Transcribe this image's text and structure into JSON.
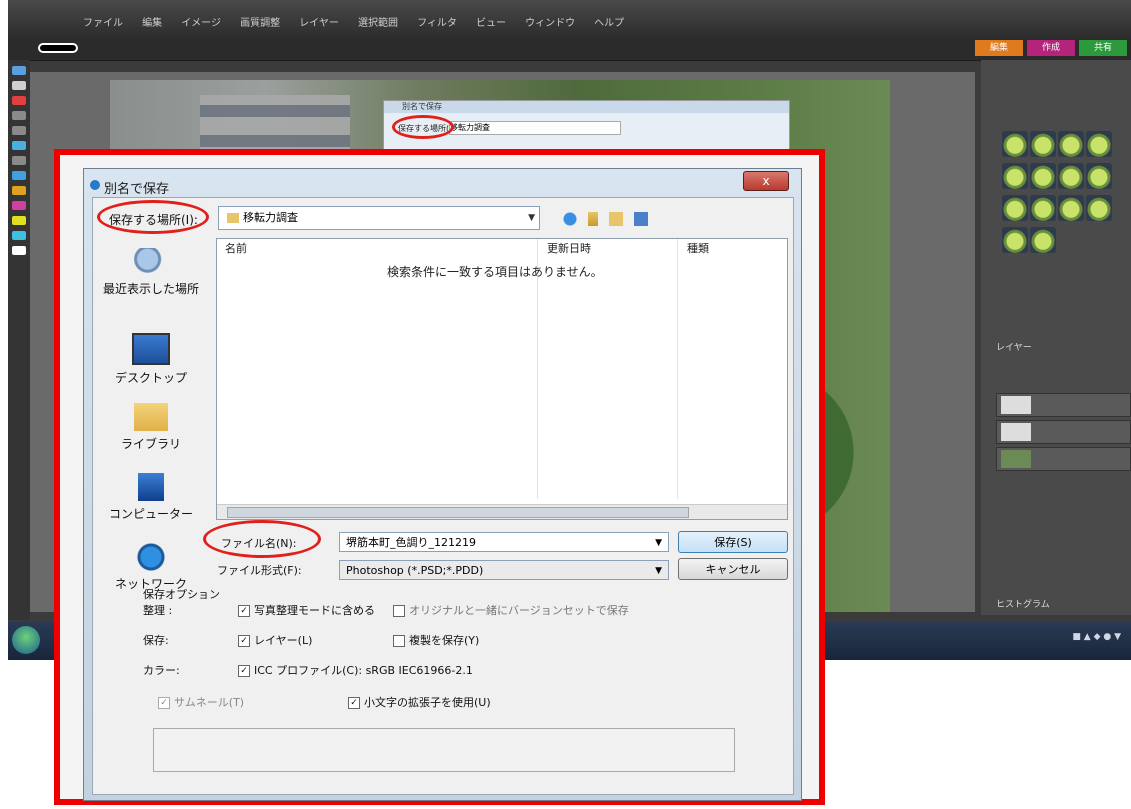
{
  "photoshop": {
    "menus": [
      "ファイル",
      "編集",
      "イメージ",
      "画質調整",
      "レイヤー",
      "選択範囲",
      "フィルタ",
      "ビュー",
      "ウィンドウ",
      "ヘルプ"
    ],
    "mode_tabs": [
      "編集",
      "作成",
      "共有"
    ],
    "panels": {
      "layers_title": "レイヤー",
      "histogram_title": "ヒストグラム"
    },
    "background_dialog": {
      "title": "別名で保存",
      "location_label": "保存する場所(I):",
      "folder": "移転力調査"
    }
  },
  "dialog": {
    "title": "別名で保存",
    "close_label": "x",
    "location_label": "保存する場所(I):",
    "location_value": "移転力調査",
    "columns": [
      "名前",
      "更新日時",
      "種類"
    ],
    "empty_message": "検索条件に一致する項目はありません。",
    "places": [
      "最近表示した場所",
      "デスクトップ",
      "ライブラリ",
      "コンピューター",
      "ネットワーク"
    ],
    "filename_label": "ファイル名(N):",
    "filename_value": "堺筋本町_色調り_121219",
    "filetype_label": "ファイル形式(F):",
    "filetype_value": "Photoshop (*.PSD;*.PDD)",
    "save_button": "保存(S)",
    "cancel_button": "キャンセル",
    "save_options_title": "保存オプション",
    "organize_label": "整理 :",
    "organize_opt1": "写真整理モードに含める",
    "organize_opt2": "オリジナルと一緒にバージョンセットで保存",
    "save_label": "保存:",
    "save_opt1": "レイヤー(L)",
    "save_opt2": "複製を保存(Y)",
    "color_label": "カラー:",
    "color_opt": "ICC プロファイル(C): sRGB IEC61966-2.1",
    "thumbnail_opt": "サムネール(T)",
    "lowercase_opt": "小文字の拡張子を使用(U)"
  }
}
